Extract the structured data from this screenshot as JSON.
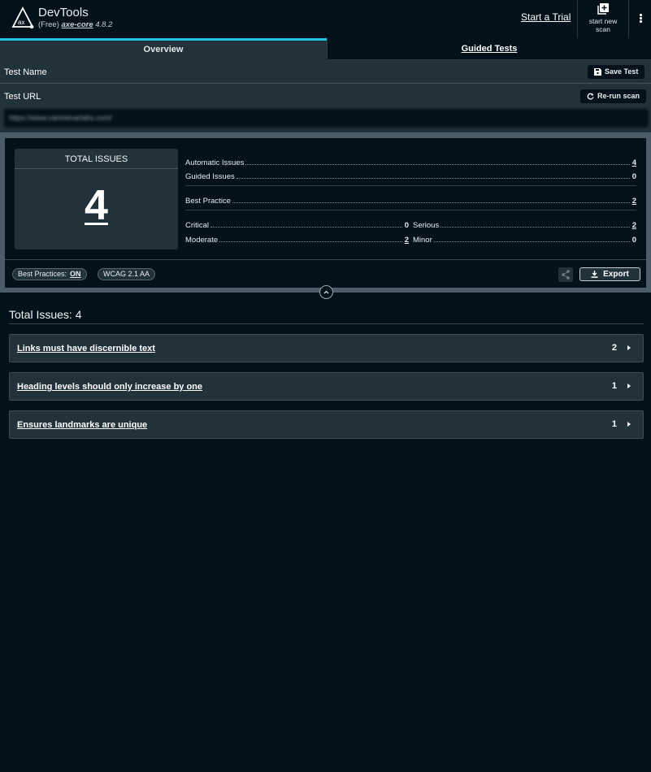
{
  "header": {
    "app_title": "DevTools",
    "edition": "(Free)",
    "engine": "axe-core",
    "version": "4.8.2",
    "trial_link": "Start a Trial",
    "new_scan_label_line1": "start new",
    "new_scan_label_line2": "scan"
  },
  "tabs": [
    {
      "label": "Overview",
      "active": true
    },
    {
      "label": "Guided Tests",
      "active": false
    }
  ],
  "test": {
    "name_label": "Test Name",
    "save_label": "Save Test",
    "url_label": "Test URL",
    "rerun_label": "Re-run scan",
    "url_value": "https://www.vanmevarlabs.com/"
  },
  "summary": {
    "total_label": "TOTAL ISSUES",
    "total_value": "4",
    "automatic_label": "Automatic Issues",
    "automatic_value": "4",
    "guided_label": "Guided Issues",
    "guided_value": "0",
    "best_practice_label": "Best Practice",
    "best_practice_value": "2",
    "critical_label": "Critical",
    "critical_value": "0",
    "serious_label": "Serious",
    "serious_value": "2",
    "moderate_label": "Moderate",
    "moderate_value": "2",
    "minor_label": "Minor",
    "minor_value": "0",
    "best_practices_pill_label": "Best Practices:",
    "best_practices_pill_value": "ON",
    "standard_pill": "WCAG 2.1 AA",
    "export_label": "Export"
  },
  "issues": {
    "title": "Total Issues: 4",
    "items": [
      {
        "title": "Links must have discernible text",
        "count": "2"
      },
      {
        "title": "Heading levels should only increase by one",
        "count": "1"
      },
      {
        "title": "Ensures landmarks are unique",
        "count": "1"
      }
    ]
  },
  "colors": {
    "accent": "#1fc3e6",
    "background": "#03121a",
    "panel": "#22323b"
  }
}
